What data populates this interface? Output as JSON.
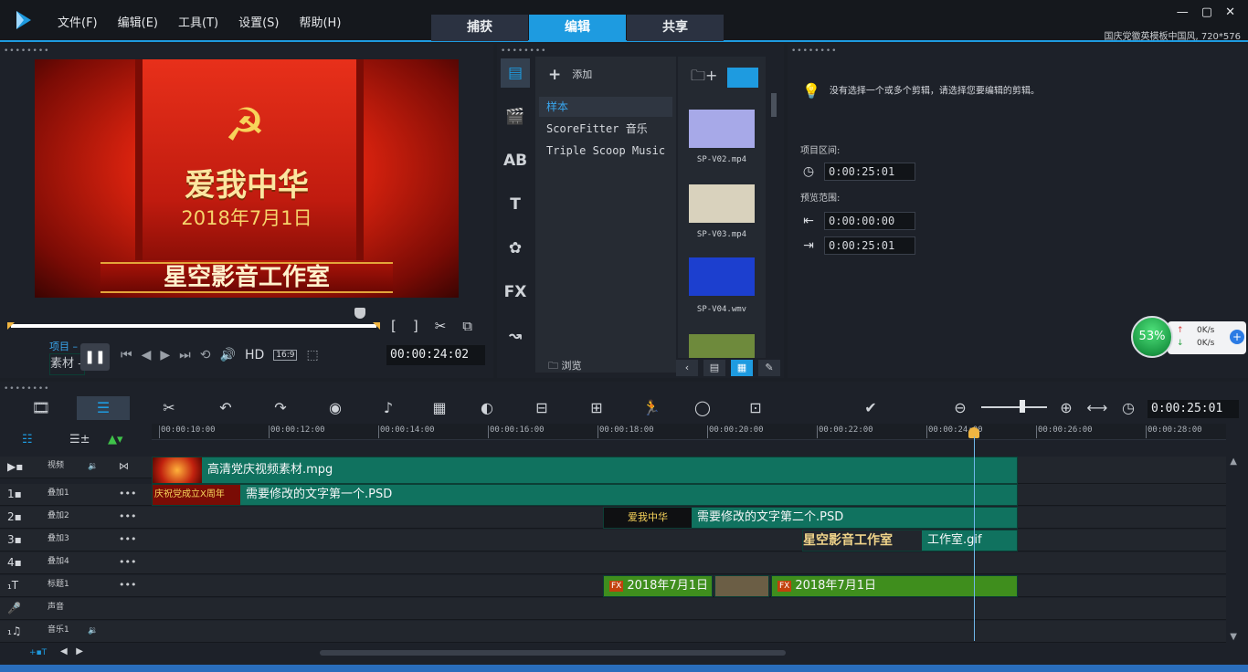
{
  "menu": [
    "文件(F)",
    "编辑(E)",
    "工具(T)",
    "设置(S)",
    "帮助(H)"
  ],
  "mode_tabs": [
    "捕获",
    "编辑",
    "共享"
  ],
  "active_tab": "编辑",
  "window_controls": [
    "—",
    "▢",
    "✕"
  ],
  "project_info": "国庆党徽英模板中国风, 720*576",
  "player": {
    "preview": {
      "line1": "爱我中华",
      "line2": "2018年7月1日",
      "ribbon": "星空影音工作室"
    },
    "mode_project": "项目",
    "mode_clip": "素材",
    "hd_label": "HD",
    "ratio_label": "16:9",
    "timecode": "00:00:24:02"
  },
  "library": {
    "add_label": "添加",
    "browse_label": "浏览",
    "tree": [
      "样本",
      "ScoreFitter 音乐",
      "Triple Scoop Music"
    ],
    "thumbs": [
      {
        "name": "SP-V02.mp4",
        "color": "#a7a9e8"
      },
      {
        "name": "SP-V03.mp4",
        "color": "#d9d2bd"
      },
      {
        "name": "SP-V04.wmv",
        "color": "#1c3fcf"
      }
    ]
  },
  "options": {
    "hint": "没有选择一个或多个剪辑，请选择您要编辑的剪辑。",
    "project_range_label": "项目区间:",
    "project_range": "0:00:25:01",
    "preview_range_label": "预览范围:",
    "preview_start": "0:00:00:00",
    "preview_end": "0:00:25:01"
  },
  "net": {
    "percent": "53%",
    "up": "0K/s",
    "down": "0K/s"
  },
  "timeline": {
    "timecode": "0:00:25:01",
    "ruler": [
      "00:00:10:00",
      "00:00:12:00",
      "00:00:14:00",
      "00:00:16:00",
      "00:00:18:00",
      "00:00:20:00",
      "00:00:22:00",
      "00:00:24:00",
      "00:00:26:00",
      "00:00:28:00"
    ],
    "tracks": [
      {
        "id": "video",
        "name": "视频"
      },
      {
        "id": "overlay1",
        "name": "叠加1"
      },
      {
        "id": "overlay2",
        "name": "叠加2"
      },
      {
        "id": "overlay3",
        "name": "叠加3"
      },
      {
        "id": "overlay4",
        "name": "叠加4"
      },
      {
        "id": "title",
        "name": "标题1"
      },
      {
        "id": "voice",
        "name": "声音"
      },
      {
        "id": "music",
        "name": "音乐1"
      }
    ],
    "clips": {
      "video": "高清党庆视频素材.mpg",
      "overlay1_thumb": "庆祝党成立X周年",
      "overlay1": "需要修改的文字第一个.PSD",
      "overlay2_thumb": "爱我中华",
      "overlay2": "需要修改的文字第二个.PSD",
      "overlay3_thumb": "星空影音工作室",
      "overlay3": "工作室.gif",
      "title_a": "2018年7月1日",
      "title_b": "2018年7月1日",
      "fx": "FX"
    }
  }
}
